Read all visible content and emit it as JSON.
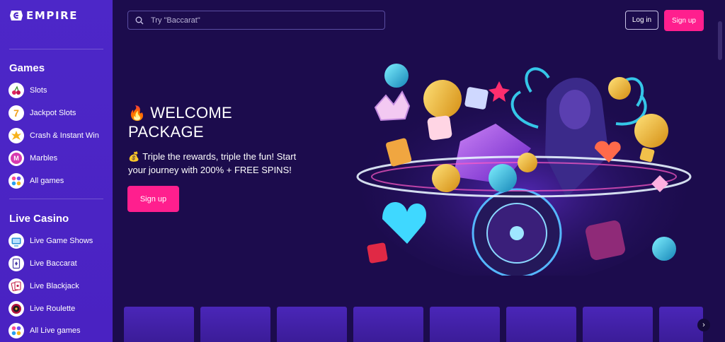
{
  "brand": {
    "name": "EMPIRE"
  },
  "sidebar": {
    "sections": [
      {
        "heading": "Games",
        "items": [
          {
            "label": "Slots",
            "icon": "cherry-icon"
          },
          {
            "label": "Jackpot Slots",
            "icon": "seven-icon"
          },
          {
            "label": "Crash & Instant Win",
            "icon": "explosion-icon"
          },
          {
            "label": "Marbles",
            "icon": "marble-icon"
          },
          {
            "label": "All games",
            "icon": "grid-icon"
          }
        ]
      },
      {
        "heading": "Live Casino",
        "items": [
          {
            "label": "Live Game Shows",
            "icon": "tv-icon"
          },
          {
            "label": "Live Baccarat",
            "icon": "card-icon"
          },
          {
            "label": "Live Blackjack",
            "icon": "cards-icon"
          },
          {
            "label": "Live Roulette",
            "icon": "roulette-icon"
          },
          {
            "label": "All Live games",
            "icon": "grid-icon"
          }
        ]
      }
    ]
  },
  "header": {
    "search_placeholder": "Try \"Baccarat\"",
    "login_label": "Log in",
    "signup_label": "Sign up"
  },
  "hero": {
    "emoji": "🔥",
    "title": "WELCOME PACKAGE",
    "bag_emoji": "💰",
    "subtitle": "Triple the rewards, triple the fun! Start your journey with 200% + FREE SPINS!",
    "cta_label": "Sign up"
  },
  "colors": {
    "accent": "#ff1f8e",
    "sidebar": "#4d27c8",
    "background": "#1c0c4d"
  }
}
